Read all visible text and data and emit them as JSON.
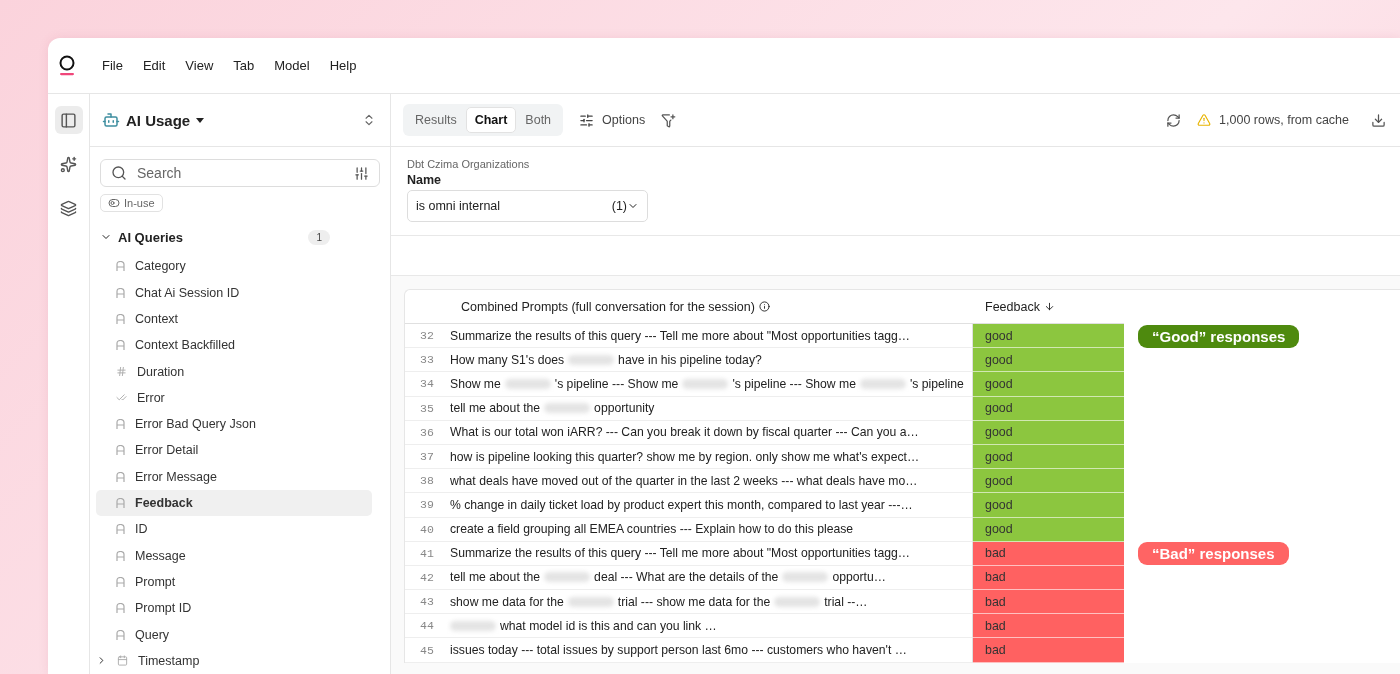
{
  "menu": [
    "File",
    "Edit",
    "View",
    "Tab",
    "Model",
    "Help"
  ],
  "rail": [
    {
      "kind": "panel",
      "selected": true
    },
    {
      "kind": "sparkle",
      "selected": false
    },
    {
      "kind": "layers",
      "selected": false
    }
  ],
  "sidebar": {
    "title": "AI Usage",
    "search": {
      "placeholder": "Search"
    },
    "chip": "In-use",
    "groups": [
      {
        "label": "AI Queries",
        "count": "1",
        "expanded": true,
        "children": [
          {
            "label": "Category",
            "kind": "text",
            "selected": false
          },
          {
            "label": "Chat Ai Session ID",
            "kind": "text",
            "selected": false
          },
          {
            "label": "Context",
            "kind": "text",
            "selected": false
          },
          {
            "label": "Context Backfilled",
            "kind": "text",
            "selected": false
          },
          {
            "label": "Duration",
            "kind": "number",
            "selected": false
          },
          {
            "label": "Error",
            "kind": "boolean",
            "selected": false
          },
          {
            "label": "Error Bad Query Json",
            "kind": "text",
            "selected": false
          },
          {
            "label": "Error Detail",
            "kind": "text",
            "selected": false
          },
          {
            "label": "Error Message",
            "kind": "text",
            "selected": false
          },
          {
            "label": "Feedback",
            "kind": "text",
            "selected": true
          },
          {
            "label": "ID",
            "kind": "text",
            "selected": false
          },
          {
            "label": "Message",
            "kind": "text",
            "selected": false
          },
          {
            "label": "Prompt",
            "kind": "text",
            "selected": false
          },
          {
            "label": "Prompt ID",
            "kind": "text",
            "selected": false
          },
          {
            "label": "Query",
            "kind": "text",
            "selected": false
          },
          {
            "label": "Timestamp",
            "kind": "date",
            "expanded": false,
            "selected": false
          }
        ]
      }
    ]
  },
  "toolbar": {
    "tabs": [
      {
        "label": "Results",
        "selected": false
      },
      {
        "label": "Chart",
        "selected": true
      },
      {
        "label": "Both",
        "selected": false
      }
    ],
    "options": "Options",
    "status": "1,000 rows, from cache"
  },
  "filter": {
    "source": "Dbt Czima Organizations",
    "field": "Name",
    "value": "is omni internal",
    "count": "(1)"
  },
  "table": {
    "columns": [
      "Combined Prompts (full conversation for the session)",
      "Feedback"
    ],
    "rows": [
      {
        "num": "32",
        "prompt": [
          {
            "kind": "text",
            "text": "Summarize the results of this query --- Tell me more about \"Most opportunities tagg…"
          }
        ],
        "feedback": "good",
        "color": "#8cc63f",
        "annotation": {
          "text": "“Good” responses",
          "color": "#4e8a0e"
        }
      },
      {
        "num": "33",
        "prompt": [
          {
            "kind": "text",
            "text": "How many S1's does"
          },
          {
            "kind": "redacted"
          },
          {
            "kind": "text",
            "text": "have in his pipeline today?"
          }
        ],
        "feedback": "good",
        "color": "#8cc63f"
      },
      {
        "num": "34",
        "prompt": [
          {
            "kind": "text",
            "text": "Show me"
          },
          {
            "kind": "redacted"
          },
          {
            "kind": "text",
            "text": "'s pipeline --- Show me"
          },
          {
            "kind": "redacted"
          },
          {
            "kind": "text",
            "text": "'s pipeline --- Show me"
          },
          {
            "kind": "redacted"
          },
          {
            "kind": "text",
            "text": "'s pipeline"
          }
        ],
        "feedback": "good",
        "color": "#8cc63f"
      },
      {
        "num": "35",
        "prompt": [
          {
            "kind": "text",
            "text": "tell me about the"
          },
          {
            "kind": "redacted"
          },
          {
            "kind": "text",
            "text": "opportunity"
          }
        ],
        "feedback": "good",
        "color": "#8cc63f"
      },
      {
        "num": "36",
        "prompt": [
          {
            "kind": "text",
            "text": "What is our total won iARR? --- Can you break it down by fiscal quarter --- Can you a…"
          }
        ],
        "feedback": "good",
        "color": "#8cc63f"
      },
      {
        "num": "37",
        "prompt": [
          {
            "kind": "text",
            "text": "how is pipeline looking this quarter? show me by region. only show me what's expect…"
          }
        ],
        "feedback": "good",
        "color": "#8cc63f"
      },
      {
        "num": "38",
        "prompt": [
          {
            "kind": "text",
            "text": "what deals have moved out of the quarter in the last 2 weeks --- what deals have mo…"
          }
        ],
        "feedback": "good",
        "color": "#8cc63f"
      },
      {
        "num": "39",
        "prompt": [
          {
            "kind": "text",
            "text": "% change in daily ticket load by product expert this month, compared to last year ---…"
          }
        ],
        "feedback": "good",
        "color": "#8cc63f"
      },
      {
        "num": "40",
        "prompt": [
          {
            "kind": "text",
            "text": "create a field grouping all EMEA countries --- Explain how to do this please"
          }
        ],
        "feedback": "good",
        "color": "#8cc63f"
      },
      {
        "num": "41",
        "prompt": [
          {
            "kind": "text",
            "text": "Summarize the results of this query --- Tell me more about \"Most opportunities tagg…"
          }
        ],
        "feedback": "bad",
        "color": "#ff6161",
        "annotation": {
          "text": "“Bad” responses",
          "color": "#ff6464"
        }
      },
      {
        "num": "42",
        "prompt": [
          {
            "kind": "text",
            "text": "tell me about the"
          },
          {
            "kind": "redacted"
          },
          {
            "kind": "text",
            "text": "deal --- What are the details of the"
          },
          {
            "kind": "redacted"
          },
          {
            "kind": "text",
            "text": "opportu…"
          }
        ],
        "feedback": "bad",
        "color": "#ff6161"
      },
      {
        "num": "43",
        "prompt": [
          {
            "kind": "text",
            "text": "show me data for the"
          },
          {
            "kind": "redacted"
          },
          {
            "kind": "text",
            "text": "trial --- show me data for the"
          },
          {
            "kind": "redacted"
          },
          {
            "kind": "text",
            "text": "trial --…"
          }
        ],
        "feedback": "bad",
        "color": "#ff6161"
      },
      {
        "num": "44",
        "prompt": [
          {
            "kind": "redacted"
          },
          {
            "kind": "text",
            "text": "what model id is this and can you link …"
          }
        ],
        "feedback": "bad",
        "color": "#ff6161"
      },
      {
        "num": "45",
        "prompt": [
          {
            "kind": "text",
            "text": "issues today --- total issues by support person last 6mo --- customers who haven't …"
          }
        ],
        "feedback": "bad",
        "color": "#ff6161"
      }
    ]
  }
}
